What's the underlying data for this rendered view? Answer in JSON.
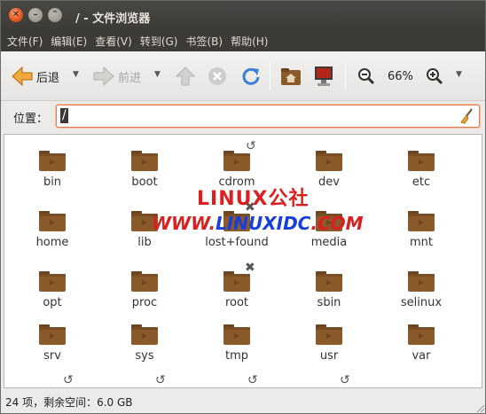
{
  "window": {
    "title": "/ - 文件浏览器"
  },
  "menubar": [
    {
      "label": "文件(F)"
    },
    {
      "label": "编辑(E)"
    },
    {
      "label": "查看(V)"
    },
    {
      "label": "转到(G)"
    },
    {
      "label": "书签(B)"
    },
    {
      "label": "帮助(H)"
    }
  ],
  "toolbar": {
    "back_label": "后退",
    "forward_label": "前进",
    "zoom_level": "66%",
    "icons": [
      "back-arrow-icon",
      "forward-arrow-icon",
      "up-arrow-icon",
      "stop-icon",
      "reload-icon",
      "home-folder-icon",
      "computer-icon",
      "zoom-out-icon",
      "zoom-in-icon"
    ]
  },
  "location": {
    "label": "位置：",
    "value": "/"
  },
  "files": [
    {
      "name": "bin"
    },
    {
      "name": "boot"
    },
    {
      "name": "cdrom"
    },
    {
      "name": "dev"
    },
    {
      "name": "etc"
    },
    {
      "name": "home"
    },
    {
      "name": "lib"
    },
    {
      "name": "lost+found"
    },
    {
      "name": "media"
    },
    {
      "name": "mnt"
    },
    {
      "name": "opt"
    },
    {
      "name": "proc"
    },
    {
      "name": "root"
    },
    {
      "name": "sbin"
    },
    {
      "name": "selinux"
    },
    {
      "name": "srv"
    },
    {
      "name": "sys"
    },
    {
      "name": "tmp"
    },
    {
      "name": "usr"
    },
    {
      "name": "var"
    }
  ],
  "watermark": {
    "line1": "LINUX公社",
    "line2a": "WWW.",
    "line2b": "LINUXIDC",
    "line2c": ".COM"
  },
  "status": {
    "text": "24 项，剩余空间：6.0 GB"
  },
  "colors": {
    "folder": "#8b5a2b",
    "folder_dark": "#6e4420",
    "accent": "#e67a4b",
    "watermark": "#d91f1f"
  }
}
